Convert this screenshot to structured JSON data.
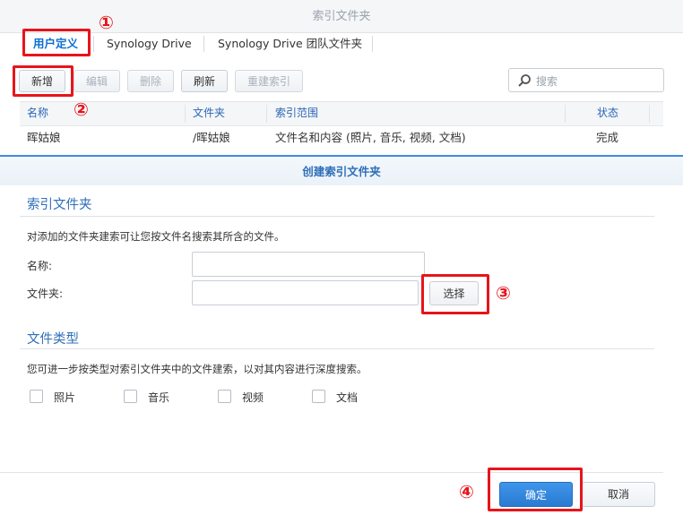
{
  "window": {
    "title": "索引文件夹"
  },
  "tabs": [
    {
      "label": "用户定义"
    },
    {
      "label": "Synology Drive"
    },
    {
      "label": "Synology Drive 团队文件夹"
    }
  ],
  "toolbar": {
    "add_label": "新增",
    "edit_label": "编辑",
    "delete_label": "删除",
    "refresh_label": "刷新",
    "reindex_label": "重建索引",
    "search_placeholder": "搜索"
  },
  "table": {
    "columns": [
      "名称",
      "文件夹",
      "索引范围",
      "状态"
    ],
    "rows": [
      [
        "晖姑娘",
        "/晖姑娘",
        "文件名和内容 (照片, 音乐, 视频, 文档)",
        "完成"
      ]
    ]
  },
  "dialog": {
    "title": "创建索引文件夹",
    "section1_title": "索引文件夹",
    "section1_desc": "对添加的文件夹建索可让您按文件名搜索其所含的文件。",
    "name_label": "名称:",
    "name_value": "",
    "folder_label": "文件夹:",
    "folder_value": "",
    "browse_label": "选择",
    "section2_title": "文件类型",
    "section2_desc": "您可进一步按类型对索引文件夹中的文件建索，以对其内容进行深度搜索。",
    "file_types": [
      {
        "label": "照片",
        "checked": false
      },
      {
        "label": "音乐",
        "checked": false
      },
      {
        "label": "视频",
        "checked": false
      },
      {
        "label": "文档",
        "checked": false
      }
    ],
    "ok_label": "确定",
    "cancel_label": "取消"
  },
  "annotations": [
    "①",
    "②",
    "③",
    "④"
  ],
  "colors": {
    "accent": "#2f6fb8",
    "primary_button": "#2a7ad2",
    "annotation_red": "#e8141b"
  }
}
